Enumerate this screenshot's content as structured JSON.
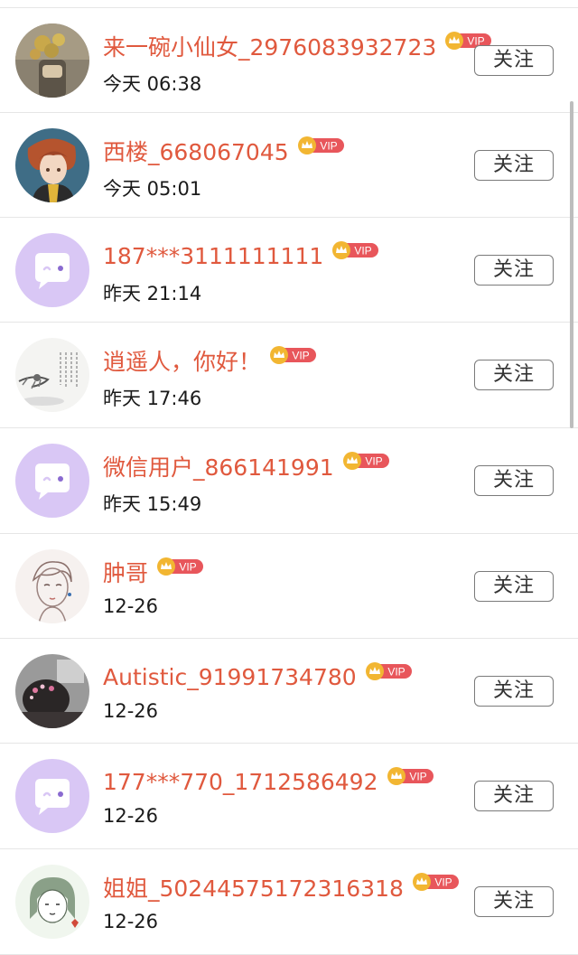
{
  "follow_label": "关注",
  "vip_label": "VIP",
  "colors": {
    "name": "#e0593e",
    "vip_badge": "#e8565b",
    "crown": "#f2b632",
    "default_avatar_bg": "#d9c7f5",
    "default_avatar_icon": "#ffffff"
  },
  "users": [
    {
      "name": "来一碗小仙女_2976083932723",
      "time": "今天 06:38",
      "avatar": "photo-flowers"
    },
    {
      "name": "西楼_668067045",
      "time": "今天 05:01",
      "avatar": "anime-boy"
    },
    {
      "name": "187***3111111111",
      "time": "昨天 21:14",
      "avatar": "default-chat-bubble"
    },
    {
      "name": "逍遥人，你好！",
      "time": "昨天 17:46",
      "avatar": "ink-painting"
    },
    {
      "name": "微信用户_866141991",
      "time": "昨天 15:49",
      "avatar": "default-chat-bubble"
    },
    {
      "name": "肿哥",
      "time": "12-26",
      "avatar": "sketch-portrait"
    },
    {
      "name": "Autistic_91991734780",
      "time": "12-26",
      "avatar": "photo-dark"
    },
    {
      "name": "177***770_1712586492",
      "time": "12-26",
      "avatar": "default-chat-bubble"
    },
    {
      "name": "姐姐_50244575172316318",
      "time": "12-26",
      "avatar": "cartoon-girl"
    }
  ]
}
